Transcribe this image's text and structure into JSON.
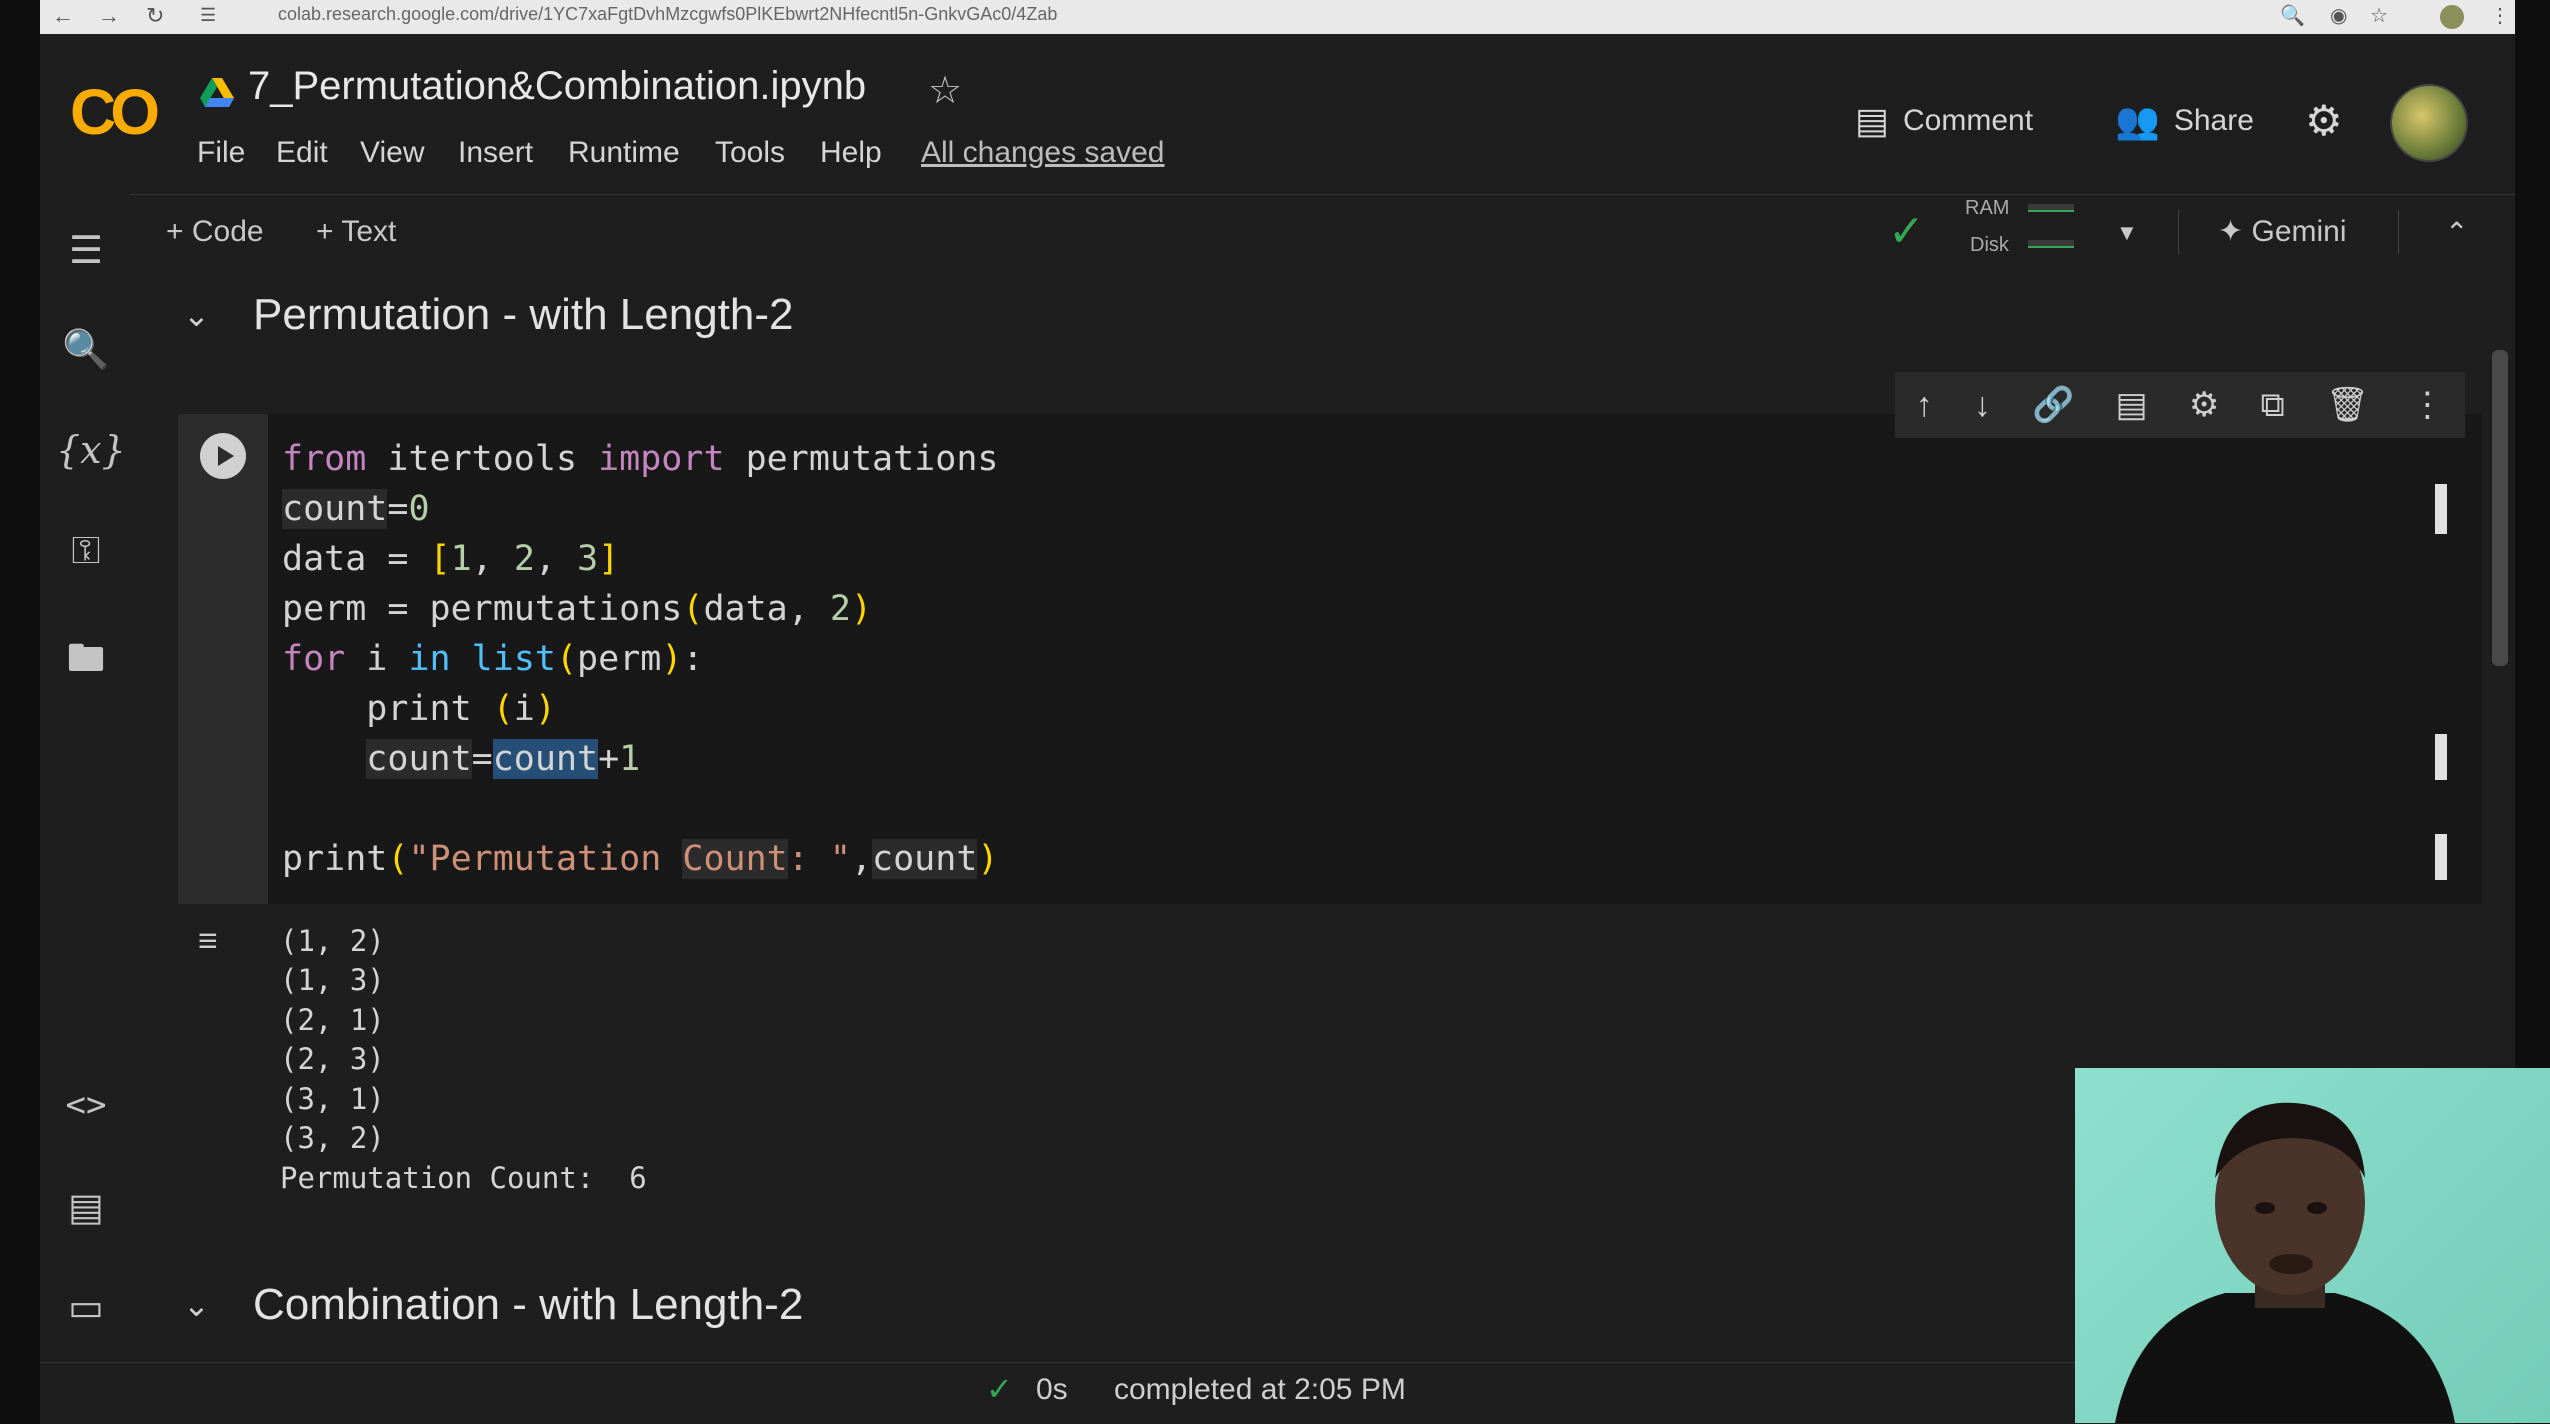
{
  "browser": {
    "url": "colab.research.google.com/drive/1YC7xaFgtDvhMzcgwfs0PlKEbwrt2NHfecntl5n-GnkvGAc0/4Zab"
  },
  "header": {
    "logo": "CO",
    "notebook_title": "7_Permutation&Combination.ipynb",
    "menu": [
      "File",
      "Edit",
      "View",
      "Insert",
      "Runtime",
      "Tools",
      "Help"
    ],
    "save_status": "All changes saved",
    "comment_label": "Comment",
    "share_label": "Share"
  },
  "toolbar": {
    "add_code": "+ Code",
    "add_text": "+ Text",
    "ram_label": "RAM",
    "disk_label": "Disk",
    "gemini_label": "Gemini"
  },
  "sections": [
    {
      "title": "Permutation - with Length-2"
    },
    {
      "title": "Combination - with Length-2"
    }
  ],
  "cell": {
    "code_lines": [
      "from itertools import permutations",
      "count=0",
      "data = [1, 2, 3]",
      "perm = permutations(data, 2)",
      "for i in list(perm):",
      "    print (i)",
      "    count=count+1",
      "",
      "print(\"Permutation Count: \",count)"
    ],
    "output_lines": [
      "(1, 2)",
      "(1, 3)",
      "(2, 1)",
      "(2, 3)",
      "(3, 1)",
      "(3, 2)",
      "Permutation Count:  6"
    ]
  },
  "status": {
    "duration": "0s",
    "message": "completed at 2:05 PM"
  },
  "icons": {
    "toc": "table-of-contents-icon",
    "search": "search-icon",
    "variables": "variables-icon",
    "secrets": "key-icon",
    "files": "folder-icon",
    "code_snippets": "code-icon",
    "command_palette": "command-palette-icon",
    "terminal": "terminal-icon"
  },
  "colors": {
    "brand": "#f9ab00",
    "background": "#1e1e1e",
    "connected": "#34a853"
  }
}
